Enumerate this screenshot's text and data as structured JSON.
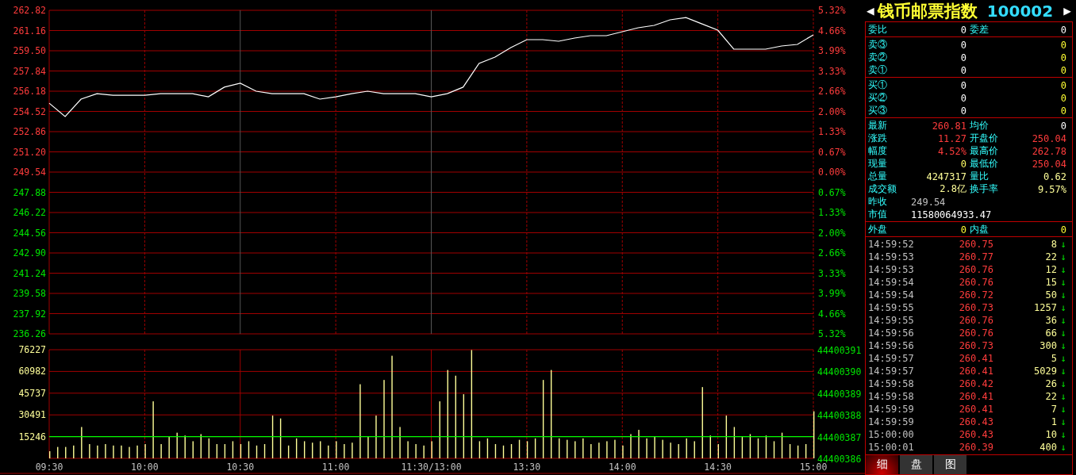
{
  "price_chart": {
    "chart_data": {
      "type": "line",
      "grid": true,
      "ylim": [
        236.26,
        262.82
      ],
      "yticks": [
        {
          "value": 262.82,
          "label": "262.82"
        },
        {
          "value": 261.16,
          "label": "261.16"
        },
        {
          "value": 259.5,
          "label": "259.50"
        },
        {
          "value": 257.84,
          "label": "257.84"
        },
        {
          "value": 256.18,
          "label": "256.18"
        },
        {
          "value": 254.52,
          "label": "254.52"
        },
        {
          "value": 252.86,
          "label": "252.86"
        },
        {
          "value": 251.2,
          "label": "251.20"
        },
        {
          "value": 249.54,
          "label": "249.54"
        },
        {
          "value": 247.88,
          "label": "247.88"
        },
        {
          "value": 246.22,
          "label": "246.22"
        },
        {
          "value": 244.56,
          "label": "244.56"
        },
        {
          "value": 242.9,
          "label": "242.90"
        },
        {
          "value": 241.24,
          "label": "241.24"
        },
        {
          "value": 239.58,
          "label": "239.58"
        },
        {
          "value": 237.92,
          "label": "237.92"
        },
        {
          "value": 236.26,
          "label": "236.26"
        }
      ],
      "categories": [
        null,
        null,
        null,
        null,
        null,
        null,
        null,
        null,
        null,
        null,
        null,
        null,
        null,
        null,
        null,
        null,
        null,
        null,
        null,
        null,
        null,
        null,
        null,
        null,
        null,
        null,
        null,
        null,
        null,
        null,
        null,
        null,
        null,
        null,
        null,
        null,
        null,
        null,
        null,
        null,
        null,
        null,
        null,
        null,
        null,
        null,
        null,
        null,
        null
      ],
      "series": [
        {
          "color": "#ffffff",
          "values": [
            255.2,
            254.1,
            255.53,
            255.98,
            255.85,
            255.85,
            255.85,
            255.98,
            255.98,
            255.98,
            255.72,
            256.51,
            256.83,
            256.18,
            255.98,
            255.98,
            255.98,
            255.53,
            255.72,
            255.98,
            256.18,
            255.98,
            255.98,
            255.98,
            255.72,
            255.98,
            256.51,
            258.46,
            258.98,
            259.76,
            260.41,
            260.41,
            260.28,
            260.54,
            260.74,
            260.74,
            261.06,
            261.39,
            261.58,
            262.04,
            262.23,
            261.71,
            261.19,
            259.63,
            259.63,
            259.63,
            259.89,
            260.02,
            260.81
          ]
        }
      ]
    },
    "right_axis_labels": [
      "5.32%",
      "4.66%",
      "3.99%",
      "3.33%",
      "2.66%",
      "2.00%",
      "1.33%",
      "0.67%",
      "0.00%",
      "0.67%",
      "1.33%",
      "2.00%",
      "2.66%",
      "3.33%",
      "3.99%",
      "4.66%",
      "5.32%"
    ]
  },
  "volume_chart": {
    "chart_data": {
      "type": "bar",
      "grid": true,
      "ref_lines": [
        {
          "axis": "y",
          "value": 15246,
          "color": "#00ff00"
        }
      ],
      "ylim": [
        0,
        76227
      ],
      "yticks": [
        76227,
        60982,
        45737,
        30491,
        15246
      ],
      "categories": [
        "09:30",
        null,
        null,
        null,
        null,
        null,
        null,
        null,
        null,
        null,
        null,
        null,
        "10:00",
        null,
        null,
        null,
        null,
        null,
        null,
        null,
        null,
        null,
        null,
        null,
        "10:30",
        null,
        null,
        null,
        null,
        null,
        null,
        null,
        null,
        null,
        null,
        null,
        "11:00",
        null,
        null,
        null,
        null,
        null,
        null,
        null,
        null,
        null,
        null,
        null,
        "11:30/13:00",
        null,
        null,
        null,
        null,
        null,
        null,
        null,
        null,
        null,
        null,
        null,
        "13:30",
        null,
        null,
        null,
        null,
        null,
        null,
        null,
        null,
        null,
        null,
        null,
        "14:00",
        null,
        null,
        null,
        null,
        null,
        null,
        null,
        null,
        null,
        null,
        null,
        "14:30",
        null,
        null,
        null,
        null,
        null,
        null,
        null,
        null,
        null,
        null,
        null,
        "15:00"
      ],
      "series": [
        {
          "color": "#ffff99",
          "values": [
            5000,
            8000,
            8000,
            9000,
            22000,
            10000,
            9000,
            10000,
            9000,
            9000,
            8000,
            9000,
            10000,
            40000,
            10000,
            15000,
            18000,
            16000,
            12000,
            17000,
            14000,
            10000,
            10000,
            12000,
            10000,
            12000,
            9000,
            10000,
            30000,
            28000,
            9000,
            14000,
            12000,
            11000,
            12000,
            9000,
            12000,
            10000,
            11000,
            52000,
            15000,
            30000,
            55000,
            72000,
            22000,
            12000,
            10000,
            9000,
            12000,
            40000,
            62000,
            58000,
            45000,
            76000,
            12000,
            14000,
            10000,
            9000,
            10000,
            13000,
            12000,
            14000,
            55000,
            62000,
            14000,
            13000,
            12000,
            14000,
            10000,
            11000,
            12000,
            13000,
            9000,
            17000,
            20000,
            14000,
            15000,
            13000,
            11000,
            10000,
            14000,
            12000,
            50000,
            16000,
            10000,
            30000,
            22000,
            15000,
            17000,
            14000,
            16000,
            12000,
            18000,
            10000,
            9000,
            10000,
            33000
          ]
        }
      ]
    },
    "right_axis_labels": [
      "44400391",
      "44400390",
      "44400389",
      "44400388",
      "44400387",
      "44400386"
    ]
  },
  "quote_panel": {
    "title": "钱币邮票指数",
    "code": "100002",
    "prev_arrow": "◀",
    "next_arrow": "▶",
    "order_ratio": [
      {
        "label": "委比",
        "value": "0"
      },
      {
        "label": "委差",
        "value": "0"
      }
    ],
    "asks": [
      {
        "label": "卖③",
        "price": "0",
        "volume": "0"
      },
      {
        "label": "卖②",
        "price": "0",
        "volume": "0"
      },
      {
        "label": "卖①",
        "price": "0",
        "volume": "0"
      }
    ],
    "bids": [
      {
        "label": "买①",
        "price": "0",
        "volume": "0"
      },
      {
        "label": "买②",
        "price": "0",
        "volume": "0"
      },
      {
        "label": "买③",
        "price": "0",
        "volume": "0"
      }
    ],
    "stats": [
      [
        {
          "label": "最新",
          "value": "260.81",
          "color": "#ff3c3c"
        },
        {
          "label": "均价",
          "value": "0",
          "color": "#ffffff"
        }
      ],
      [
        {
          "label": "涨跌",
          "value": "11.27",
          "color": "#ff3c3c"
        },
        {
          "label": "开盘价",
          "value": "250.04",
          "color": "#ff3c3c"
        }
      ],
      [
        {
          "label": "幅度",
          "value": "4.52%",
          "color": "#ff3c3c"
        },
        {
          "label": "最高价",
          "value": "262.78",
          "color": "#ff3c3c"
        }
      ],
      [
        {
          "label": "现量",
          "value": "0",
          "color": "#ffff66"
        },
        {
          "label": "最低价",
          "value": "250.04",
          "color": "#ff3c3c"
        }
      ],
      [
        {
          "label": "总量",
          "value": "4247317",
          "color": "#ffff99"
        },
        {
          "label": "量比",
          "value": "0.62",
          "color": "#ffff99"
        }
      ],
      [
        {
          "label": "成交额",
          "value": "2.8亿",
          "color": "#ffff99"
        },
        {
          "label": "换手率",
          "value": "9.57%",
          "color": "#ffff99"
        }
      ],
      [
        {
          "label": "昨收",
          "value": "249.54",
          "color": "#c0c0c0"
        }
      ],
      [
        {
          "label": "市值",
          "value": "11580064933.47",
          "color": "#ffffff"
        }
      ]
    ],
    "outer_inner": [
      {
        "label": "外盘",
        "value": "0"
      },
      {
        "label": "内盘",
        "value": "0"
      }
    ],
    "ticks": [
      {
        "time": "14:59:52",
        "price": "260.75",
        "volume": "8",
        "dir": "↓"
      },
      {
        "time": "14:59:53",
        "price": "260.77",
        "volume": "22",
        "dir": "↓"
      },
      {
        "time": "14:59:53",
        "price": "260.76",
        "volume": "12",
        "dir": "↓"
      },
      {
        "time": "14:59:54",
        "price": "260.76",
        "volume": "15",
        "dir": "↓"
      },
      {
        "time": "14:59:54",
        "price": "260.72",
        "volume": "50",
        "dir": "↓"
      },
      {
        "time": "14:59:55",
        "price": "260.73",
        "volume": "1257",
        "dir": "↓"
      },
      {
        "time": "14:59:55",
        "price": "260.76",
        "volume": "36",
        "dir": "↓"
      },
      {
        "time": "14:59:56",
        "price": "260.76",
        "volume": "66",
        "dir": "↓"
      },
      {
        "time": "14:59:56",
        "price": "260.73",
        "volume": "300",
        "dir": "↓"
      },
      {
        "time": "14:59:57",
        "price": "260.41",
        "volume": "5",
        "dir": "↓"
      },
      {
        "time": "14:59:57",
        "price": "260.41",
        "volume": "5029",
        "dir": "↓"
      },
      {
        "time": "14:59:58",
        "price": "260.42",
        "volume": "26",
        "dir": "↓"
      },
      {
        "time": "14:59:58",
        "price": "260.41",
        "volume": "22",
        "dir": "↓"
      },
      {
        "time": "14:59:59",
        "price": "260.41",
        "volume": "7",
        "dir": "↓"
      },
      {
        "time": "14:59:59",
        "price": "260.43",
        "volume": "1",
        "dir": "↓"
      },
      {
        "time": "15:00:00",
        "price": "260.43",
        "volume": "10",
        "dir": "↓"
      },
      {
        "time": "15:00:01",
        "price": "260.39",
        "volume": "400",
        "dir": "↓"
      }
    ],
    "tabs": [
      {
        "label": "细",
        "selected": true
      },
      {
        "label": "盘",
        "selected": false
      },
      {
        "label": "图",
        "selected": false
      }
    ]
  }
}
